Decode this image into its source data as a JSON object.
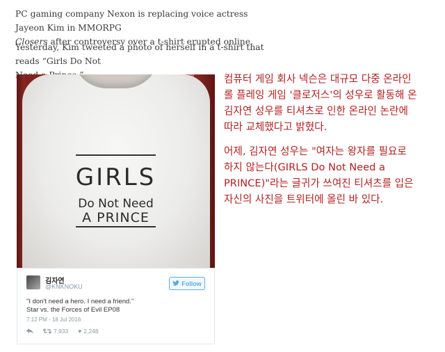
{
  "article": {
    "p1_line1": "PC gaming company Nexon is replacing voice actress Jayeon Kim in MMORPG",
    "p1_line2_em": "Closers",
    "p1_line2_rest": " after controversy over a t-shirt erupted online.",
    "p2_line1": "Yesterday, Kim tweeted a photo of herself in a t-shirt that reads “Girls Do Not",
    "p2_line2": "Need a Prince.”"
  },
  "shirt": {
    "line1": "GIRLS",
    "line2": "Do Not Need",
    "line3": "A PRINCE"
  },
  "tweet": {
    "name": "김자연",
    "handle": "@KNKNOKU",
    "follow_label": "Follow",
    "text_line1": "\"I don't need a hero. I need a friend.\"",
    "text_line2": "Star vs. the Forces of Evil EP08",
    "timestamp": "7:12 PM - 18 Jul 2016",
    "retweets": "7,933",
    "likes": "2,248",
    "icons": [
      "reply-icon",
      "retweet-icon",
      "heart-icon",
      "twitter-bird-icon"
    ]
  },
  "korean": {
    "p1_l1": "컴퓨터 게임 회사 넥슨은 대규모 다중 온라인",
    "p1_l2": "롤 플레잉 게임 '클로저스'의 성우로 활동해 온",
    "p1_l3": "김자연 성우를 티셔츠로 인한 온라인 논란에",
    "p1_l4": "따라 교체했다고 밝혔다.",
    "p2_l1": "어제, 김자연 성우는 \"여자는 왕자를 필요로",
    "p2_l2": "하지 않는다(GIRLS Do Not Need a",
    "p2_l3": "PRINCE)\"라는 글귀가 쓰여진 티셔츠를 입은",
    "p2_l4": "자신의 사진을 트위터에 올린 바 있다."
  },
  "colors": {
    "korean_text": "#b22020",
    "twitter_blue": "#55acee"
  }
}
